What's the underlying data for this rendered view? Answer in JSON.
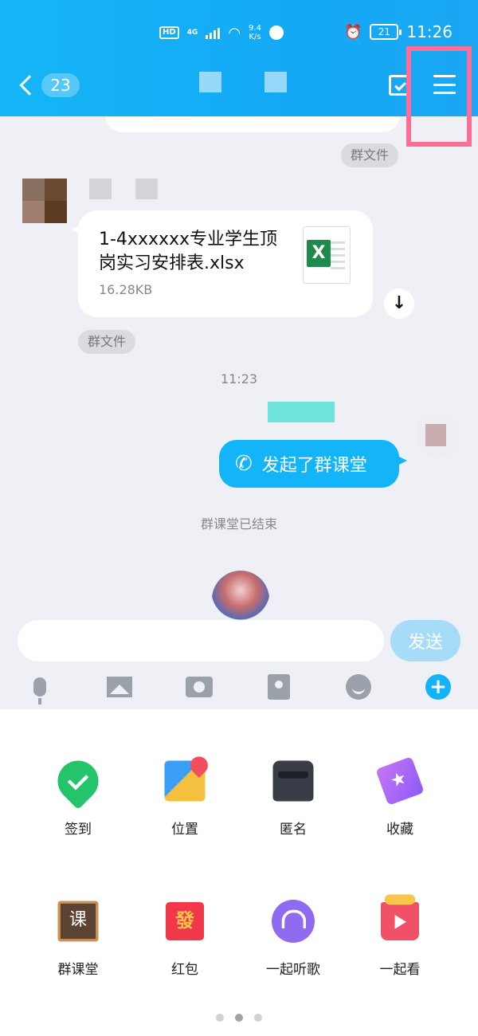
{
  "status_bar": {
    "hd": "HD",
    "network": "4G",
    "speed_top": "9.4",
    "speed_unit": "K/s",
    "battery": "21",
    "time": "11:26"
  },
  "header": {
    "unread_count": "23",
    "icons": {
      "back": "chevron-left-icon",
      "calendar": "calendar-check-icon",
      "menu": "hamburger-menu-icon"
    }
  },
  "chat": {
    "group_file_tag": "群文件",
    "file_message": {
      "file_name": "1-4xxxxxx专业学生顶岗实习安排表.xlsx",
      "file_size": "16.28KB",
      "file_type_icon": "excel-icon"
    },
    "timestamp": "11:23",
    "call_message": "发起了群课堂",
    "system_notice": "群课堂已结束"
  },
  "input": {
    "placeholder": "",
    "send_label": "发送"
  },
  "toolbar": [
    "microphone-icon",
    "image-icon",
    "camera-icon",
    "red-packet-icon",
    "emoji-icon",
    "plus-icon"
  ],
  "panel": {
    "items": [
      {
        "label": "签到",
        "icon": "check-in-icon"
      },
      {
        "label": "位置",
        "icon": "location-icon"
      },
      {
        "label": "匿名",
        "icon": "anonymous-icon"
      },
      {
        "label": "收藏",
        "icon": "favorite-icon"
      },
      {
        "label": "群课堂",
        "icon": "group-class-icon",
        "glyph": "课"
      },
      {
        "label": "红包",
        "icon": "red-packet-icon",
        "glyph": "發"
      },
      {
        "label": "一起听歌",
        "icon": "listen-together-icon"
      },
      {
        "label": "一起看",
        "icon": "watch-together-icon"
      }
    ],
    "page_count": 3,
    "current_page": 2
  },
  "colors": {
    "header": "#15b6f7",
    "bubble_self": "#13b5f8",
    "highlight_box": "#ff6d96"
  }
}
